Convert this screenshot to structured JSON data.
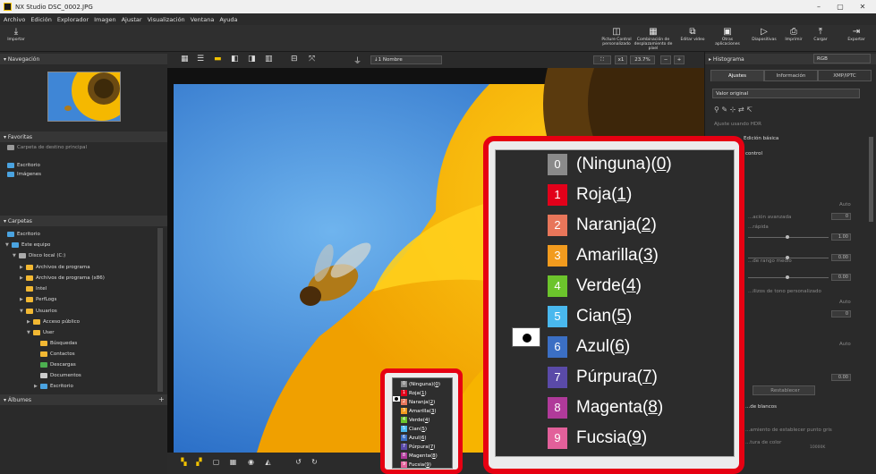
{
  "window": {
    "title": "NX Studio   DSC_0002.JPG",
    "minimize": "–",
    "maximize": "▢",
    "close": "✕"
  },
  "menu": [
    "Archivo",
    "Edición",
    "Explorador",
    "Imagen",
    "Ajustar",
    "Visualización",
    "Ventana",
    "Ayuda"
  ],
  "toolbar": {
    "import": "Importar",
    "picture_control": "Picture Control personalizado",
    "pixel_shift": "Combinación de desplazamiento de píxel",
    "edit_video": "Editar vídeo",
    "other_apps": "Otras aplicaciones",
    "slideshow": "Diapositivas",
    "print": "Imprimir",
    "upload": "Cargar",
    "export": "Exportar"
  },
  "left": {
    "navigation": "Navegación",
    "favorites": "Favoritas",
    "fav_items": [
      "Carpeta de destino principal",
      "Escritorio",
      "Imágenes"
    ],
    "folders": "Carpetas",
    "tree": [
      "Escritorio",
      "Este equipo",
      "Disco local (C:)",
      "Archivos de programa",
      "Archivos de programa (x86)",
      "Intel",
      "PerfLogs",
      "Usuarios",
      "Acceso público",
      "User",
      "Búsquedas",
      "Contactos",
      "Descargas",
      "Documentos",
      "Escritorio"
    ],
    "albums": "Álbumes",
    "add": "+"
  },
  "center": {
    "sort": "↓1 Nombre",
    "zoom_fit": "x1",
    "zoom_pct": "23.7%"
  },
  "right": {
    "histogram": "Histograma",
    "channel": "RGB",
    "tabs": [
      "Ajustes",
      "Información",
      "XMP/IPTC"
    ],
    "preset": "Valor original",
    "hdr": "Ajuste usando HDR",
    "basic": "Edición básica",
    "control": "control",
    "advanced": "...ación avanzada",
    "rapida": "...rápida",
    "auto": "Auto",
    "mid_range": "...de rango medio",
    "custom_tone": "...ilizos de tono personalizado",
    "restore": "Restablecer",
    "wb": "...de blancos",
    "set_gray": "...amiento de establecer punto gris",
    "color_temp": "...tura de color",
    "vals": [
      "0",
      "1.00",
      "0.00",
      "0.00",
      "0",
      "0.00"
    ],
    "k": "10000K"
  },
  "labels": [
    {
      "num": "0",
      "name": "(Ninguna)",
      "key": "0",
      "color": "#8a8a8a"
    },
    {
      "num": "1",
      "name": "Roja",
      "key": "1",
      "color": "#e2001a"
    },
    {
      "num": "2",
      "name": "Naranja",
      "key": "2",
      "color": "#e8765a"
    },
    {
      "num": "3",
      "name": "Amarilla",
      "key": "3",
      "color": "#f29b1e"
    },
    {
      "num": "4",
      "name": "Verde",
      "key": "4",
      "color": "#6cc42c"
    },
    {
      "num": "5",
      "name": "Cian",
      "key": "5",
      "color": "#49b8ee"
    },
    {
      "num": "6",
      "name": "Azul",
      "key": "6",
      "color": "#3b6fc4"
    },
    {
      "num": "7",
      "name": "Púrpura",
      "key": "7",
      "color": "#5a4aa8"
    },
    {
      "num": "8",
      "name": "Magenta",
      "key": "8",
      "color": "#b03a9a"
    },
    {
      "num": "9",
      "name": "Fucsia",
      "key": "9",
      "color": "#e2609a"
    }
  ],
  "checked_label": "1",
  "accent": "#e60012"
}
